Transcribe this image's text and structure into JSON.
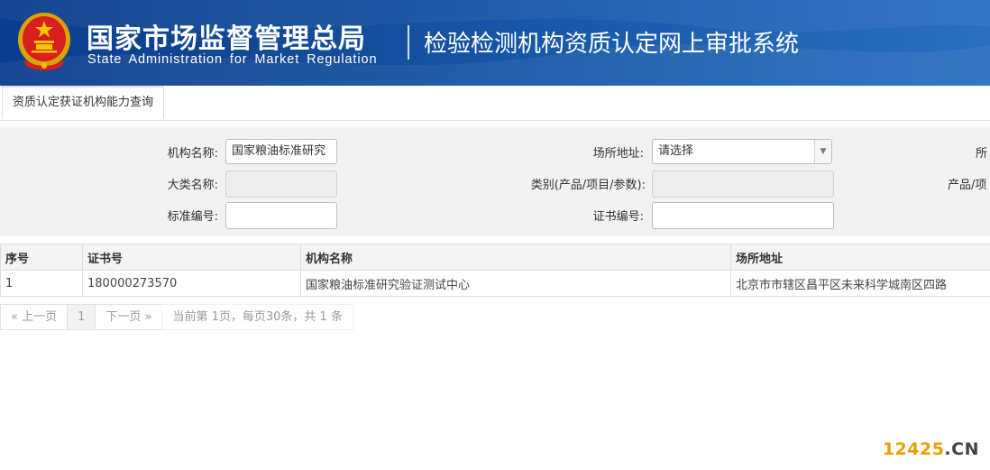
{
  "header": {
    "org_name_cn": "国家市场监督管理总局",
    "org_name_en": "State Administration for Market Regulation",
    "system_title": "检验检测机构资质认定网上审批系统",
    "emblem_icon": "national-emblem-icon"
  },
  "tabs": [
    {
      "label": "资质认定获证机构能力查询",
      "active": true
    }
  ],
  "search_form": {
    "org_name_label": "机构名称:",
    "org_name_value": "国家粮油标准研究",
    "site_address_label": "场所地址:",
    "site_address_value": "请选择",
    "site_partial_label": "所",
    "category_major_label": "大类名称:",
    "category_major_value": "",
    "category_label": "类别(产品/项目/参数):",
    "category_value": "",
    "product_partial_label": "产品/项",
    "standard_no_label": "标准编号:",
    "standard_no_value": "",
    "cert_no_label": "证书编号:",
    "cert_no_value": ""
  },
  "table": {
    "headers": [
      "序号",
      "证书号",
      "机构名称",
      "场所地址"
    ],
    "rows": [
      [
        "1",
        "180000273570",
        "国家粮油标准研究验证测试中心",
        "北京市市辖区昌平区未来科学城南区四路"
      ]
    ]
  },
  "pager": {
    "prev_label": "« 上一页",
    "current_page": "1",
    "next_label": "下一页 »",
    "info": "当前第 1页，每页30条，共 1 条"
  },
  "watermark": {
    "num": "12425",
    "suffix": ".CN"
  },
  "colors": {
    "banner": "#14509e",
    "watermark": "#e8a000"
  }
}
